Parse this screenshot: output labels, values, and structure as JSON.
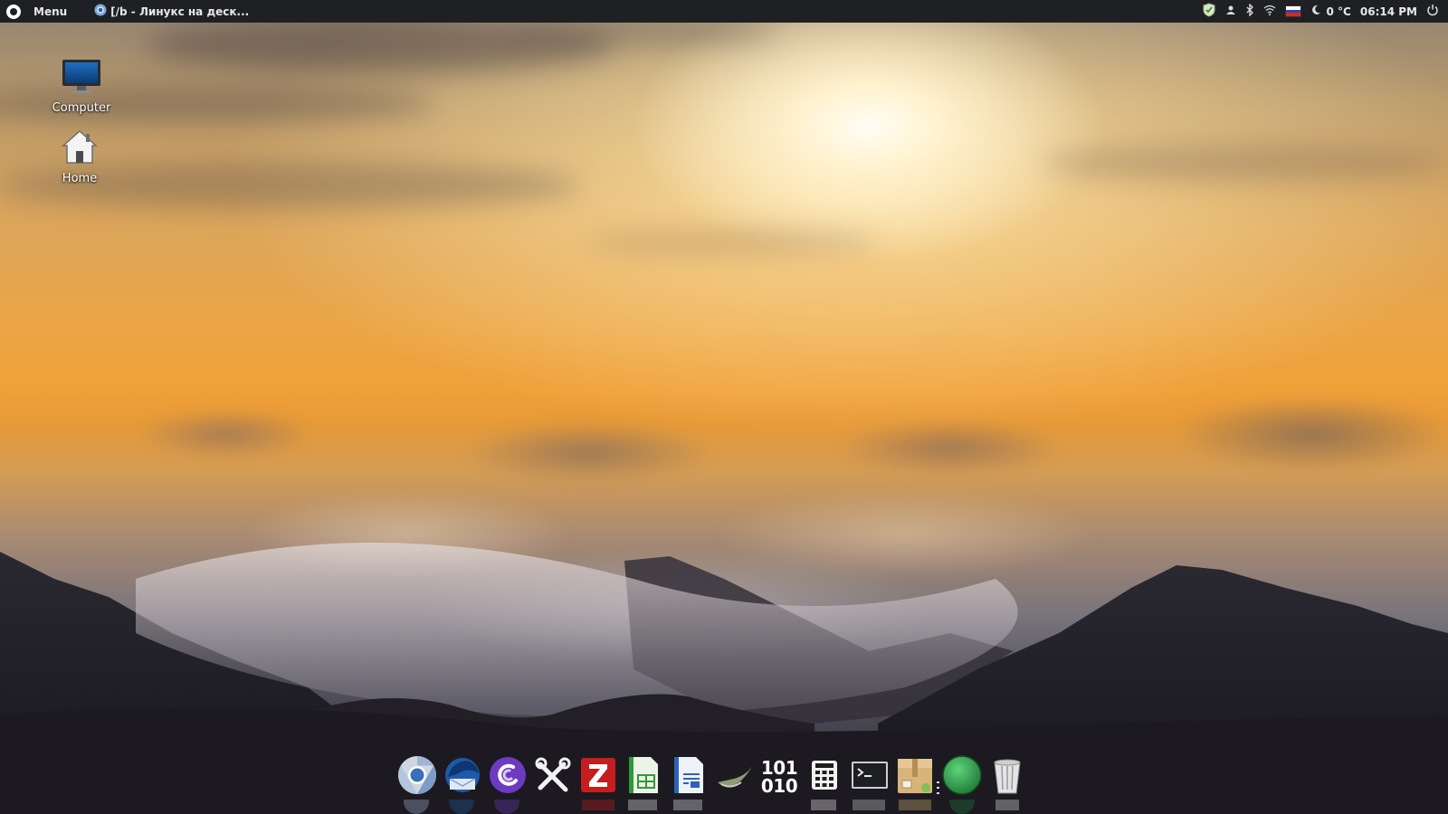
{
  "top_panel": {
    "menu_label": "Menu",
    "active_window_title": "[/b - Линукс на деск...",
    "temperature": "0 °C",
    "clock": "06:14 PM",
    "keyboard_layout_icon": "russian-flag-icon",
    "tray_icons": [
      "shield-icon",
      "user-icon",
      "bluetooth-icon",
      "wifi-icon",
      "russian-flag-icon",
      "moon-icon"
    ]
  },
  "desktop": {
    "icons": [
      {
        "label": "Computer",
        "icon": "monitor-icon"
      },
      {
        "label": "Home",
        "icon": "home-icon"
      }
    ]
  },
  "dock": {
    "items": [
      {
        "name": "chromium",
        "icon": "chromium-icon"
      },
      {
        "name": "thunderbird",
        "icon": "thunderbird-icon"
      },
      {
        "name": "torrent",
        "icon": "torrent-icon"
      },
      {
        "name": "system-tools",
        "icon": "tools-icon"
      },
      {
        "name": "filezilla",
        "icon": "filezilla-icon"
      },
      {
        "name": "spreadsheet",
        "icon": "spreadsheet-icon"
      },
      {
        "name": "text-document",
        "icon": "document-icon"
      },
      {
        "name": "ink-app",
        "icon": "swirl-icon"
      },
      {
        "name": "hex-editor",
        "icon": "binary-icon",
        "text_top": "101",
        "text_bottom": "010"
      },
      {
        "name": "calculator",
        "icon": "calculator-icon"
      },
      {
        "name": "terminal",
        "icon": "terminal-icon"
      },
      {
        "name": "archive-manager",
        "icon": "package-icon"
      },
      {
        "name": "green-app",
        "icon": "green-circle-icon"
      },
      {
        "name": "trash",
        "icon": "trash-icon"
      }
    ]
  },
  "colors": {
    "panel_bg": "#1f2023",
    "panel_text": "#e8e8e8",
    "sky_gold": "#eba546"
  }
}
